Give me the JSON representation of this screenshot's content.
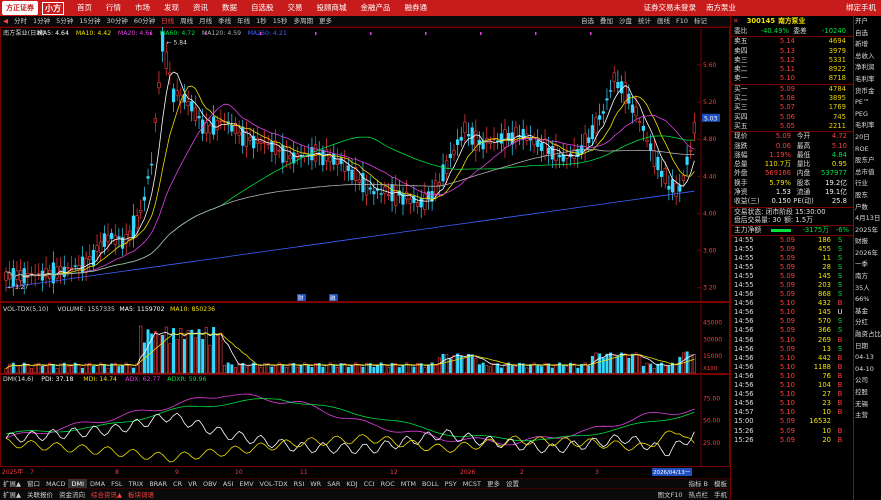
{
  "topbar": {
    "logo": "方正证券",
    "brand": "小方",
    "menu": [
      "首页",
      "行情",
      "市场",
      "发现",
      "资讯",
      "数据",
      "自选股",
      "交易",
      "投顾商城",
      "金融产品",
      "融券通"
    ],
    "right": [
      "证券交易未登录",
      "南方泵业"
    ],
    "far_right": "绑定手机"
  },
  "toolbar": {
    "items": [
      "分时",
      "1分钟",
      "5分钟",
      "15分钟",
      "30分钟",
      "60分钟",
      "日线",
      "周线",
      "月线",
      "季线",
      "年线",
      "1秒",
      "15秒",
      "多周期",
      "更多"
    ],
    "active": "日线",
    "right": [
      "自选",
      "叠加",
      "沙盘",
      "统计",
      "画线",
      "F10",
      "标记"
    ]
  },
  "main_chart": {
    "header": "南方泵业(日线)",
    "ma5": "MA5: 4.64",
    "ma10": "MA10: 4.42",
    "ma20": "MA20: 4.61",
    "ma60": "MA60: 4.72",
    "ma120": "MA120: 4.59",
    "ma250": "MA250: 4.21",
    "y_ticks": [
      "5.60",
      "5.20",
      "4.80",
      "4.40",
      "4.00",
      "3.60",
      "3.20"
    ],
    "current_tag": "5.03",
    "high_label": "5.84",
    "low_label": "3.27",
    "bubble_labels": [
      "财",
      "融"
    ]
  },
  "volume_chart": {
    "header": "VOL-TDX(5,10)",
    "volume": "VOLUME: 1557335",
    "ma5": "MA5: 1159702",
    "ma10": "MA10: 850236",
    "y_ticks": [
      "45000",
      "30000",
      "15000"
    ],
    "unit": "X100"
  },
  "dmi_chart": {
    "header": "DMI(14,6)",
    "pdi": "PDI: 37.18",
    "mdi": "MDI: 14.74",
    "adx": "ADX: 62.77",
    "adxr": "ADXR: 59.96",
    "y_ticks": [
      "75.00",
      "50.00",
      "25.00"
    ]
  },
  "x_axis": {
    "labels": [
      "2025年",
      "7",
      "8",
      "9",
      "10",
      "11",
      "12",
      "2026",
      "2",
      "3"
    ],
    "cursor_label": "2026/04/13一"
  },
  "quote": {
    "code": "300145",
    "name": "南方泵业",
    "weibi_label": "委比",
    "weibi": "-40.49%",
    "weicha_label": "委差",
    "weicha": "-10240",
    "asks": [
      {
        "label": "卖五",
        "price": "5.14",
        "vol": "4694"
      },
      {
        "label": "卖四",
        "price": "5.13",
        "vol": "3979"
      },
      {
        "label": "卖三",
        "price": "5.12",
        "vol": "5331"
      },
      {
        "label": "卖二",
        "price": "5.11",
        "vol": "8922"
      },
      {
        "label": "卖一",
        "price": "5.10",
        "vol": "8718"
      }
    ],
    "bids": [
      {
        "label": "买一",
        "price": "5.09",
        "vol": "4784"
      },
      {
        "label": "买二",
        "price": "5.08",
        "vol": "3895"
      },
      {
        "label": "买三",
        "price": "5.07",
        "vol": "1769"
      },
      {
        "label": "买四",
        "price": "5.06",
        "vol": "745"
      },
      {
        "label": "买五",
        "price": "5.05",
        "vol": "2211"
      }
    ],
    "stats": [
      {
        "l1": "现价",
        "v1": "5.09",
        "c1": "red",
        "l2": "今开",
        "v2": "4.72",
        "c2": "red"
      },
      {
        "l1": "涨跌",
        "v1": "0.06",
        "c1": "red",
        "l2": "最高",
        "v2": "5.10",
        "c2": "red"
      },
      {
        "l1": "涨幅",
        "v1": "1.19%",
        "c1": "red",
        "l2": "最低",
        "v2": "4.84",
        "c2": "green"
      },
      {
        "l1": "总量",
        "v1": "110.7万",
        "c1": "yellow",
        "l2": "量比",
        "v2": "0.95",
        "c2": "yellow"
      },
      {
        "l1": "外盘",
        "v1": "569166",
        "c1": "red",
        "l2": "内盘",
        "v2": "537977",
        "c2": "green"
      },
      {
        "l1": "换手",
        "v1": "5.79%",
        "c1": "yellow",
        "l2": "股本",
        "v2": "19.2亿",
        "c2": "white"
      },
      {
        "l1": "净资",
        "v1": "1.53",
        "c1": "white",
        "l2": "流通",
        "v2": "19.1亿",
        "c2": "white"
      },
      {
        "l1": "收益(三)",
        "v1": "0.150",
        "c1": "white",
        "l2": "PE(动)",
        "v2": "25.8",
        "c2": "white"
      }
    ],
    "status_label": "交易状态: 闭市阶段 15:30:00",
    "after_label": "盘后交易量: 30",
    "after_value": "额: 1.5万",
    "main_inflow_label": "主力净额",
    "main_inflow": "-3175万",
    "main_inflow_pct": "-6%",
    "ticks": [
      {
        "t": "14:55",
        "p": "5.09",
        "v": "186",
        "s": "S"
      },
      {
        "t": "14:55",
        "p": "5.09",
        "v": "455",
        "s": "S"
      },
      {
        "t": "14:55",
        "p": "5.09",
        "v": "11",
        "s": "S"
      },
      {
        "t": "14:55",
        "p": "5.09",
        "v": "28",
        "s": "S"
      },
      {
        "t": "14:55",
        "p": "5.09",
        "v": "145",
        "s": "S"
      },
      {
        "t": "14:55",
        "p": "5.09",
        "v": "203",
        "s": "S"
      },
      {
        "t": "14:56",
        "p": "5.09",
        "v": "868",
        "s": "S"
      },
      {
        "t": "14:56",
        "p": "5.10",
        "v": "432",
        "s": "B"
      },
      {
        "t": "14:56",
        "p": "5.10",
        "v": "145",
        "s": "U"
      },
      {
        "t": "14:56",
        "p": "5.09",
        "v": "570",
        "s": "S"
      },
      {
        "t": "14:56",
        "p": "5.09",
        "v": "366",
        "s": "S"
      },
      {
        "t": "14:56",
        "p": "5.10",
        "v": "269",
        "s": "B"
      },
      {
        "t": "14:56",
        "p": "5.09",
        "v": "13",
        "s": "S"
      },
      {
        "t": "14:56",
        "p": "5.10",
        "v": "442",
        "s": "B"
      },
      {
        "t": "14:56",
        "p": "5.10",
        "v": "1188",
        "s": "B"
      },
      {
        "t": "14:56",
        "p": "5.10",
        "v": "76",
        "s": "B"
      },
      {
        "t": "14:56",
        "p": "5.10",
        "v": "104",
        "s": "B"
      },
      {
        "t": "14:56",
        "p": "5.10",
        "v": "27",
        "s": "B"
      },
      {
        "t": "14:56",
        "p": "5.10",
        "v": "23",
        "s": "B"
      },
      {
        "t": "14:57",
        "p": "5.10",
        "v": "10",
        "s": "B"
      },
      {
        "t": "15:00",
        "p": "5.09",
        "v": "16532",
        "s": ""
      },
      {
        "t": "15:26",
        "p": "5.09",
        "v": "10",
        "s": "B"
      },
      {
        "t": "15:26",
        "p": "5.09",
        "v": "20",
        "s": "B"
      }
    ]
  },
  "far_right": {
    "items": [
      "开户",
      "自选",
      "新增",
      "",
      "总收入",
      "净利润",
      "毛利率",
      "货币金",
      "",
      "PE™",
      "PEG",
      "毛利率",
      "",
      "20日",
      "ROE",
      "股东户",
      "总市值",
      "",
      "行业",
      "股东",
      "户数",
      "",
      "4月13日",
      "2025年",
      "财报",
      "2026年",
      "一季",
      "",
      "南方",
      "35人",
      "",
      "66%",
      "",
      "基金",
      "分红",
      "",
      "融资占比",
      "日期",
      "04-13",
      "04-10",
      "",
      "公司",
      "控股",
      "无锡",
      "主营"
    ]
  },
  "bottom1": {
    "items": [
      "扩展▲",
      "窗口",
      "MACD",
      "DMI",
      "DMA",
      "FSL",
      "TRIX",
      "BRAR",
      "CR",
      "VR",
      "OBV",
      "ASI",
      "EMV",
      "VOL-TDX",
      "RSI",
      "WR",
      "SAR",
      "KDJ",
      "CCI",
      "ROC",
      "MTM",
      "BOLL",
      "PSY",
      "MCST",
      "更多",
      "设置"
    ],
    "active": "DMI",
    "right": [
      "指标 B",
      "模板"
    ]
  },
  "bottom2": {
    "items": [
      "扩展▲",
      "关联报价",
      "资金流向",
      "综合资讯▲",
      "板块词语"
    ],
    "right": [
      "图文F10",
      "热点栏",
      "手机"
    ]
  },
  "colors": {
    "up": "#ff3c3c",
    "down": "#35d8ff",
    "ma5": "#ffffff",
    "ma10": "#f0e000",
    "ma20": "#e040e0",
    "ma60": "#00e040",
    "ma120": "#b0b0b0",
    "ma250": "#4060ff"
  }
}
